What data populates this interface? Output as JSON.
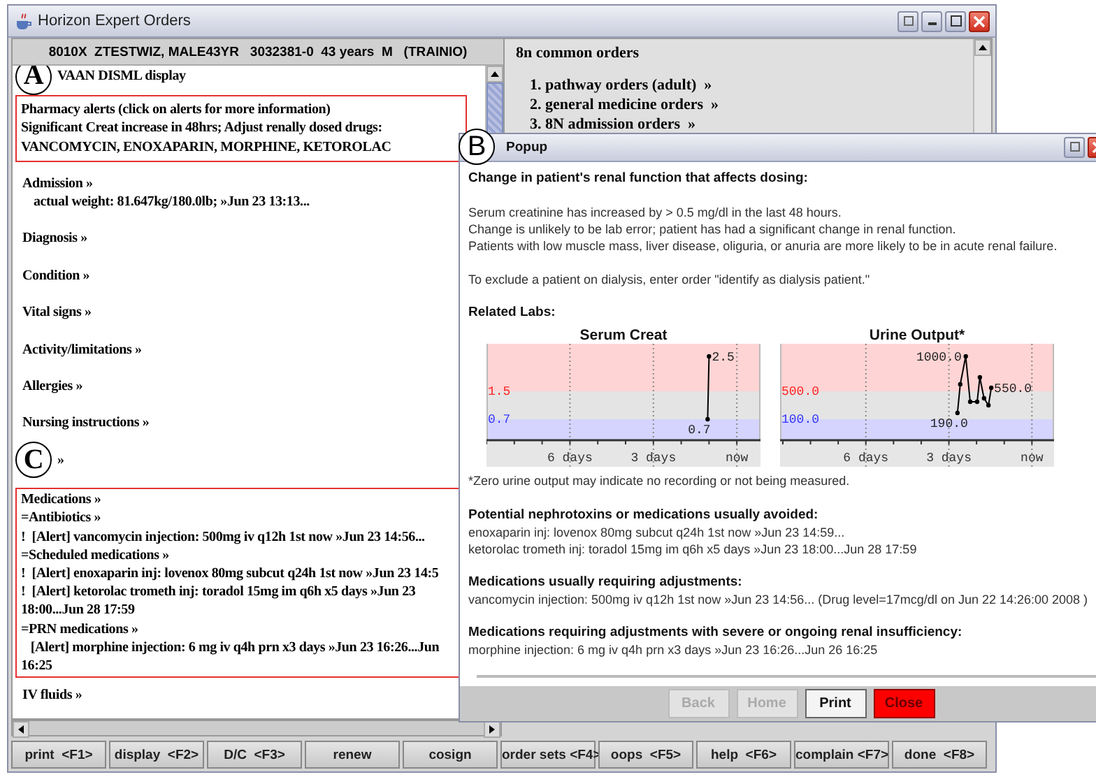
{
  "main_window": {
    "title": "Horizon Expert Orders"
  },
  "patient_header": "8010X  ZTESTWIZ, MALE43YR   3032381-0  43 years  M   (TRAINIO)",
  "left_panel": {
    "title": "VAAN DISML display",
    "alert_box": [
      "Pharmacy alerts (click on alerts for more information)",
      "Significant Creat increase in 48hrs; Adjust renally dosed drugs:",
      "VANCOMYCIN, ENOXAPARIN, MORPHINE, KETOROLAC"
    ],
    "sections": [
      {
        "heading": "Admission »",
        "lines": [
          "actual weight: 81.647kg/180.0lb; »Jun 23 13:13..."
        ]
      },
      {
        "heading": "Diagnosis »"
      },
      {
        "heading": "Condition »"
      },
      {
        "heading": "Vital signs »"
      },
      {
        "heading": "Activity/limitations »"
      },
      {
        "heading": "Allergies »"
      },
      {
        "heading": "Nursing instructions »"
      },
      {
        "heading": "»"
      }
    ],
    "medications": [
      "Medications »",
      "=Antibiotics »",
      "!  [Alert] vancomycin injection: 500mg iv q12h 1st now »Jun 23 14:56...",
      "=Scheduled medications »",
      "!  [Alert] enoxaparin inj: lovenox 80mg subcut q24h 1st now »Jun 23 14:5",
      "!  [Alert] ketorolac trometh inj: toradol 15mg im q6h x5 days »Jun 23 18:00...Jun 28 17:59",
      "=PRN medications »",
      "   [Alert] morphine injection: 6 mg iv q4h prn x3 days »Jun 23 16:26...Jun",
      "16:25"
    ],
    "trailing_section": "IV fluids »"
  },
  "right_panel": {
    "title": "8n common orders",
    "orders": [
      "1. pathway orders (adult)  »",
      "2. general medicine orders  »",
      "3. 8N admission orders  »"
    ]
  },
  "function_keys": [
    "print  <F1>",
    "display  <F2>",
    "D/C  <F3>",
    "renew",
    "cosign",
    "order sets <F4>",
    "oops  <F5>",
    "help  <F6>",
    "complain <F7>",
    "done  <F8>"
  ],
  "popup": {
    "title": "Popup",
    "heading": "Change in patient's renal function that affects dosing:",
    "lines": [
      "Serum creatinine has increased by > 0.5 mg/dl in the last 48 hours.",
      "Change is unlikely to be lab error; patient has had a significant change in renal function.",
      "Patients with low muscle mass, liver disease, oliguria, or anuria are more likely to be in acute renal failure."
    ],
    "instruction": "To exclude a patient on dialysis, enter order \"identify as dialysis patient.\"",
    "labs_heading": "Related Labs:",
    "charts": [
      {
        "chart_data": {
          "type": "line",
          "title": "Serum Creat",
          "x": [
            -1.05,
            -1.0
          ],
          "series": [
            {
              "color": "#000000",
              "marker": "circle",
              "values": [
                0.7,
                2.5
              ]
            }
          ],
          "grid": true,
          "xlim": [
            -9.0,
            0.85
          ],
          "ylim": [
            0.1,
            2.86
          ],
          "bands": [
            {
              "axis": "y",
              "from": 1.5,
              "to": 2.86,
              "color": "#ffd4d4"
            },
            {
              "axis": "y",
              "from": 0.7,
              "to": 1.5,
              "color": "#e4e4e4"
            },
            {
              "axis": "y",
              "from": 0.1,
              "to": 0.7,
              "color": "#d4d4ff"
            }
          ],
          "xticks": [
            {
              "value": -6,
              "label": "6 days"
            },
            {
              "value": -3,
              "label": "3 days"
            },
            {
              "value": 0,
              "label": "now"
            }
          ],
          "yticks": [
            {
              "value": 0.7,
              "label": "0.7"
            },
            {
              "value": 1.5,
              "label": "1.5"
            }
          ],
          "value_labels": [
            "0.7",
            "2.5"
          ]
        }
      },
      {
        "chart_data": {
          "type": "line",
          "title": "Urine Output*",
          "x": [
            -2.69,
            -2.59,
            -2.39,
            -2.23,
            -1.98,
            -1.88,
            -1.73,
            -1.57,
            -1.47
          ],
          "series": [
            {
              "color": "#000000",
              "marker": "circle",
              "values": [
                190,
                600,
                1000,
                350,
                350,
                700,
                400,
                300,
                550
              ]
            }
          ],
          "grid": true,
          "xlim": [
            -9.1,
            0.8
          ],
          "ylim": [
            -200,
            1180
          ],
          "bands": [
            {
              "axis": "y",
              "from": 500,
              "to": 1180,
              "color": "#ffd4d4"
            },
            {
              "axis": "y",
              "from": 100,
              "to": 500,
              "color": "#e4e4e4"
            },
            {
              "axis": "y",
              "from": -200,
              "to": 100,
              "color": "#d4d4ff"
            }
          ],
          "xticks": [
            {
              "value": -6,
              "label": "6 days"
            },
            {
              "value": -3,
              "label": "3 days"
            },
            {
              "value": 0,
              "label": "now"
            }
          ],
          "yticks": [
            {
              "value": 100,
              "label": "100.0"
            },
            {
              "value": 500,
              "label": "500.0"
            }
          ],
          "value_labels": [
            "190.0",
            null,
            "1000.0",
            null,
            null,
            null,
            null,
            null,
            "550.0"
          ]
        }
      }
    ],
    "footnote": "*Zero urine output may indicate no recording or not being measured.",
    "groups": [
      {
        "heading": "Potential nephrotoxins or medications usually avoided:",
        "lines": [
          "enoxaparin inj: lovenox 80mg subcut q24h 1st now »Jun 23 14:59...",
          "ketorolac trometh inj: toradol 15mg im q6h x5 days »Jun 23 18:00...Jun 28 17:59"
        ]
      },
      {
        "heading": "Medications usually requiring adjustments:",
        "lines": [
          "vancomycin injection: 500mg iv q12h 1st now »Jun 23 14:56...  (Drug level=17mcg/dl on Jun 22 14:26:00 2008 )"
        ]
      },
      {
        "heading": "Medications requiring adjustments with severe or ongoing renal insufficiency:",
        "lines": [
          "morphine injection: 6 mg iv q4h prn x3 days »Jun 23 16:26...Jun 26 16:25"
        ]
      }
    ],
    "buttons": [
      {
        "label": "Back",
        "disabled": true,
        "kind": "normal"
      },
      {
        "label": "Home",
        "disabled": true,
        "kind": "normal"
      },
      {
        "label": "Print",
        "disabled": false,
        "kind": "normal"
      },
      {
        "label": "Close",
        "disabled": false,
        "kind": "danger"
      }
    ]
  },
  "callouts": [
    "A",
    "B",
    "C"
  ]
}
